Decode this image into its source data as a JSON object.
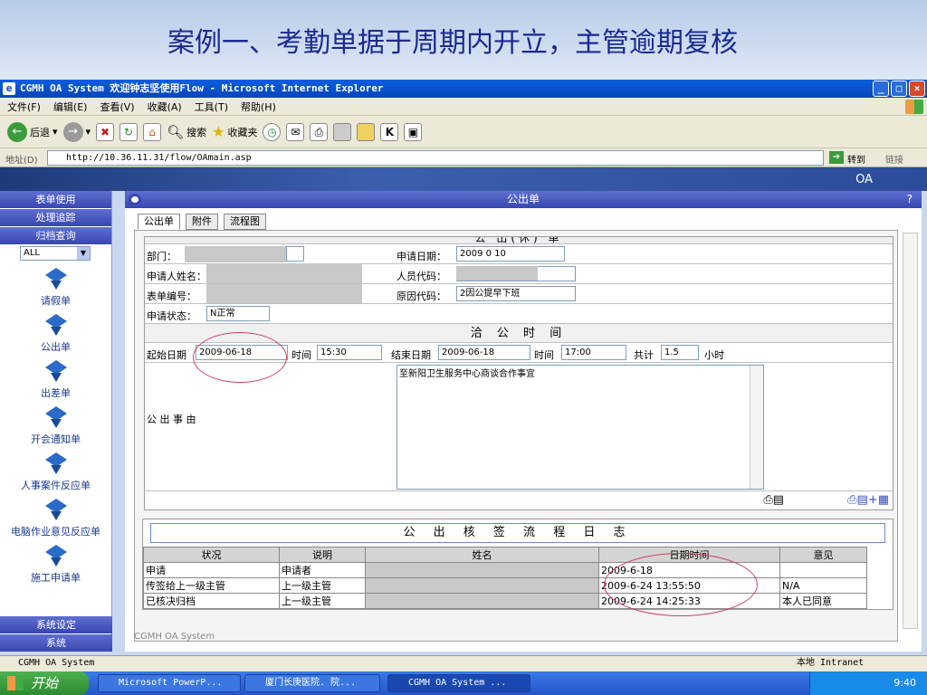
{
  "slide": {
    "title": "案例一、考勤单据于周期内开立，主管逾期复核"
  },
  "window": {
    "title": "CGMH OA System 欢迎钟志坚使用Flow - Microsoft Internet Explorer",
    "icon": "ie-icon",
    "min": "_",
    "max": "□",
    "close": "×"
  },
  "menu": [
    "文件(F)",
    "编辑(E)",
    "查看(V)",
    "收藏(A)",
    "工具(T)",
    "帮助(H)"
  ],
  "toolbar": {
    "back": "后退",
    "search": "搜索",
    "favorites": "收藏夹"
  },
  "address": {
    "label": "地址(D)",
    "url": "http://10.36.11.31/flow/OAmain.asp",
    "go": "转到",
    "links": "链接"
  },
  "banner": {
    "label": "OA"
  },
  "sidebar": {
    "nav_top": [
      "表单使用",
      "处理追踪",
      "归档查询"
    ],
    "select_value": "ALL",
    "items": [
      "请假单",
      "公出单",
      "出差单",
      "开会通知单",
      "人事案件反应单",
      "电脑作业意见反应单",
      "施工申请单"
    ],
    "nav_bottom": [
      "系统设定",
      "系统"
    ]
  },
  "main": {
    "header": "公出单",
    "help": "?",
    "tabs": [
      "公出单",
      "附件",
      "流程图"
    ],
    "form_caption": "公 出(休) 单",
    "fields": {
      "dept_label": "部门：",
      "apply_date_label": "申请日期：",
      "apply_date": "2009 0 10",
      "applicant_label": "申请人姓名：",
      "staff_code_label": "人员代码：",
      "form_no_label": "表单编号：",
      "reason_code_label": "原因代码：",
      "reason_code": "2因公提早下班",
      "status_label": "申请状态：",
      "status": "N正常"
    },
    "time_section": "洽 公 时 间",
    "time": {
      "start_date_label": "起始日期",
      "start_date": "2009-06-18",
      "time_label1": "时间",
      "start_time": "15:30",
      "end_date_label": "结束日期",
      "end_date": "2009-06-18",
      "time_label2": "时间",
      "end_time": "17:00",
      "total_label": "共计",
      "total": "1.5",
      "unit": "小时"
    },
    "reason_label": "公 出 事 由",
    "reason_text": "至新阳卫生服务中心商谈合作事宜",
    "log": {
      "title": "公 出 核 签 流 程 日 志",
      "headers": [
        "状况",
        "说明",
        "姓名",
        "日期时间",
        "意见"
      ],
      "rows": [
        [
          "申请",
          "申请者",
          "",
          "2009-6-18",
          ""
        ],
        [
          "传签给上一级主管",
          "上一级主管",
          "",
          "2009-6-24 13:55:50",
          "N/A"
        ],
        [
          "已核决归档",
          "上一级主管",
          "",
          "2009-6-24 14:25:33",
          "本人已同意"
        ]
      ]
    },
    "footer": "CGMH OA System"
  },
  "statusbar": {
    "left": "CGMH OA System",
    "right": "本地 Intranet"
  },
  "taskbar": {
    "start": "开始",
    "tasks": [
      "Microsoft PowerP...",
      "厦门长庚医院. 院...",
      "CGMH OA System ..."
    ],
    "clock": "9:40"
  }
}
